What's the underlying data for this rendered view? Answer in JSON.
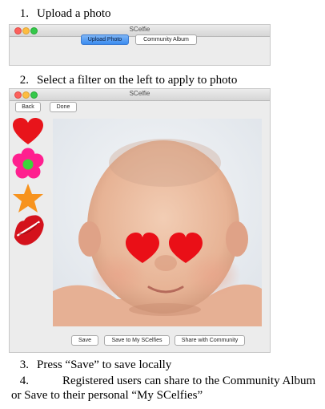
{
  "steps": [
    {
      "num": "1.",
      "text": "Upload a photo"
    },
    {
      "num": "2.",
      "text": "Select a filter on the left to apply to photo"
    },
    {
      "num": "3.",
      "text": "Press “Save” to save locally"
    },
    {
      "num": "4.",
      "text": "Registered users can share to the Community Album or Save to their personal “My SCelfies”"
    }
  ],
  "window1": {
    "title": "SCelfie",
    "upload_label": "Upload Photo",
    "album_label": "Community Album"
  },
  "window2": {
    "title": "SCelfie",
    "back_label": "Back",
    "done_label": "Done",
    "filters": [
      "heart-sticker",
      "flower-sticker",
      "star-sticker",
      "lips-sticker"
    ],
    "save_label": "Save",
    "save_my_label": "Save to My SCelfies",
    "share_label": "Share with Community"
  },
  "colors": {
    "heart": "#e8141b",
    "flower": "#ff1f8f",
    "flower_center": "#3cd43a",
    "star": "#f7931e",
    "lips": "#d4121c"
  }
}
